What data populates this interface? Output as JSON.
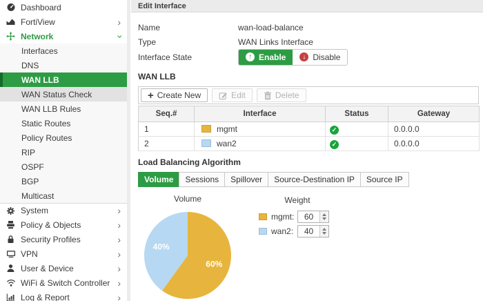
{
  "colors": {
    "accent_green": "#2d9c44",
    "accent_green_dark": "#156b2a",
    "status_green": "#18a53c",
    "disable_red": "#c64040",
    "pie_yellow": "#e7b53e",
    "pie_blue": "#b6d8f2"
  },
  "sidebar": {
    "items": [
      {
        "label": "Dashboard",
        "icon": "dashboard-icon",
        "level": "top"
      },
      {
        "label": "FortiView",
        "icon": "fortiview-icon",
        "level": "top",
        "chevron": "right"
      },
      {
        "label": "Network",
        "icon": "network-icon",
        "level": "top",
        "chevron": "down",
        "green": true
      },
      {
        "label": "Interfaces",
        "level": "sub"
      },
      {
        "label": "DNS",
        "level": "sub"
      },
      {
        "label": "WAN LLB",
        "level": "sub",
        "selected": true
      },
      {
        "label": "WAN Status Check",
        "level": "sub",
        "highlighted": true
      },
      {
        "label": "WAN LLB Rules",
        "level": "sub"
      },
      {
        "label": "Static Routes",
        "level": "sub"
      },
      {
        "label": "Policy Routes",
        "level": "sub"
      },
      {
        "label": "RIP",
        "level": "sub"
      },
      {
        "label": "OSPF",
        "level": "sub"
      },
      {
        "label": "BGP",
        "level": "sub"
      },
      {
        "label": "Multicast",
        "level": "sub"
      },
      {
        "label": "System",
        "icon": "gear-icon",
        "level": "top",
        "chevron": "right",
        "separator": true
      },
      {
        "label": "Policy & Objects",
        "icon": "policy-icon",
        "level": "top",
        "chevron": "right"
      },
      {
        "label": "Security Profiles",
        "icon": "lock-icon",
        "level": "top",
        "chevron": "right"
      },
      {
        "label": "VPN",
        "icon": "vpn-icon",
        "level": "top",
        "chevron": "right"
      },
      {
        "label": "User & Device",
        "icon": "user-icon",
        "level": "top",
        "chevron": "right"
      },
      {
        "label": "WiFi & Switch Controller",
        "icon": "wifi-icon",
        "level": "top",
        "chevron": "right"
      },
      {
        "label": "Log & Report",
        "icon": "log-report-icon",
        "level": "top",
        "chevron": "right"
      }
    ]
  },
  "header": {
    "title": "Edit Interface"
  },
  "form": {
    "name_label": "Name",
    "name_value": "wan-load-balance",
    "type_label": "Type",
    "type_value": "WAN Links Interface",
    "state_label": "Interface State",
    "enable_label": "Enable",
    "disable_label": "Disable"
  },
  "wan_llb": {
    "heading": "WAN LLB",
    "toolbar": {
      "create": "Create New",
      "edit": "Edit",
      "delete": "Delete"
    },
    "table": {
      "columns": [
        "Seq.#",
        "Interface",
        "Status",
        "Gateway"
      ],
      "rows": [
        {
          "seq": "1",
          "interface": "mgmt",
          "swatch": "#e7b53e",
          "status": "up",
          "gateway": "0.0.0.0"
        },
        {
          "seq": "2",
          "interface": "wan2",
          "swatch": "#b6d8f2",
          "status": "up",
          "gateway": "0.0.0.0"
        }
      ]
    }
  },
  "load_balancing": {
    "heading": "Load Balancing Algorithm",
    "tabs": [
      {
        "label": "Volume",
        "active": true
      },
      {
        "label": "Sessions",
        "active": false
      },
      {
        "label": "Spillover",
        "active": false
      },
      {
        "label": "Source-Destination IP",
        "active": false
      },
      {
        "label": "Source IP",
        "active": false
      }
    ],
    "weight_title": "Weight",
    "weights": [
      {
        "label": "mgmt:",
        "value": "60",
        "color": "#e7b53e"
      },
      {
        "label": "wan2:",
        "value": "40",
        "color": "#b6d8f2"
      }
    ]
  },
  "chart_data": {
    "type": "pie",
    "title": "Volume",
    "labels": [
      "mgmt",
      "wan2"
    ],
    "values": [
      60,
      40
    ],
    "colors": [
      "#e7b53e",
      "#b6d8f2"
    ],
    "slice_labels": [
      "60%",
      "40%"
    ],
    "start_angle_deg": 0,
    "direction": "clockwise",
    "legend_position": "right"
  }
}
